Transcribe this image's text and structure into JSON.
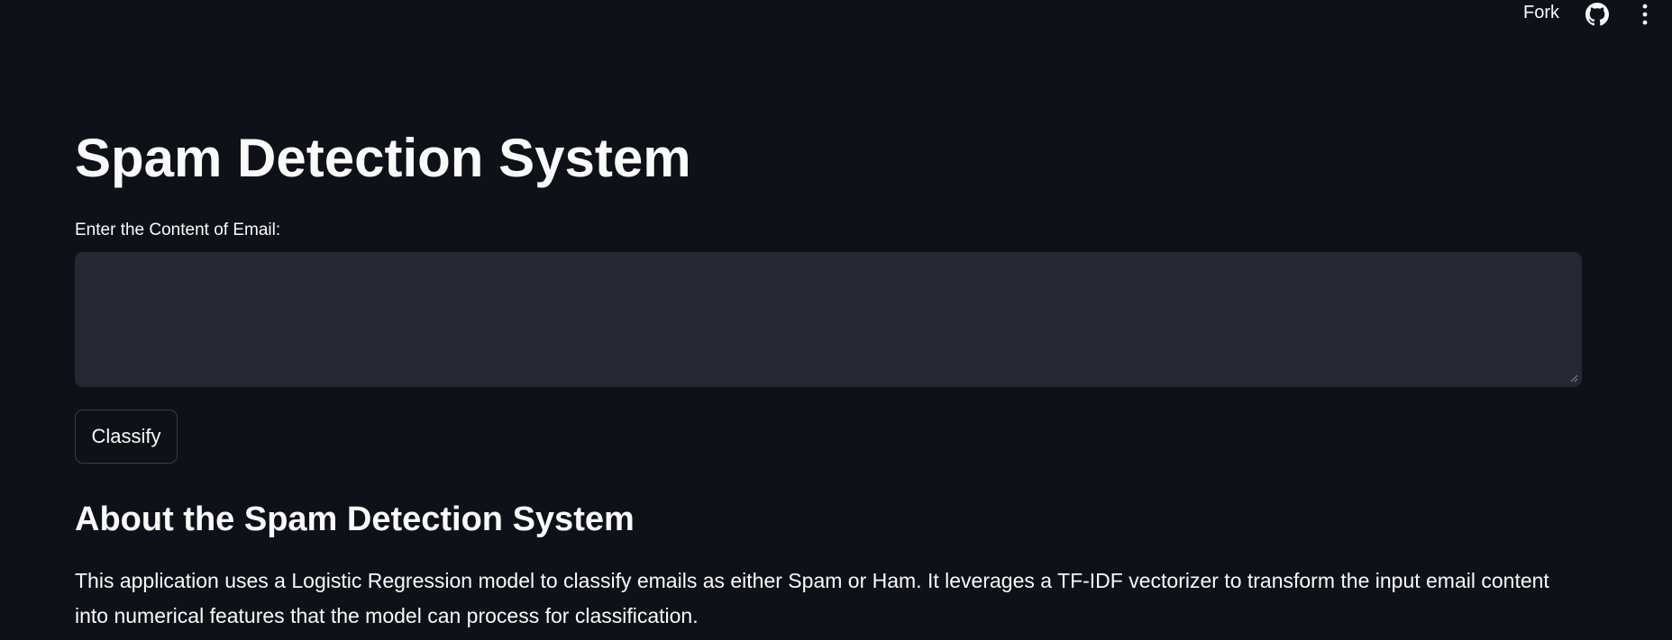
{
  "header": {
    "fork_label": "Fork",
    "github_icon": "github-icon",
    "menu_icon": "more-vertical-icon"
  },
  "main": {
    "title": "Spam Detection System",
    "email_input": {
      "label": "Enter the Content of Email:",
      "value": "",
      "placeholder": ""
    },
    "classify_button": "Classify",
    "about": {
      "heading": "About the Spam Detection System",
      "description": "This application uses a Logistic Regression model to classify emails as either Spam or Ham. It leverages a TF-IDF vectorizer to transform the input email content into numerical features that the model can process for classification."
    }
  },
  "colors": {
    "background": "#0e1117",
    "input_background": "#262730",
    "text": "#fafafa",
    "button_border": "#3b3e48"
  }
}
